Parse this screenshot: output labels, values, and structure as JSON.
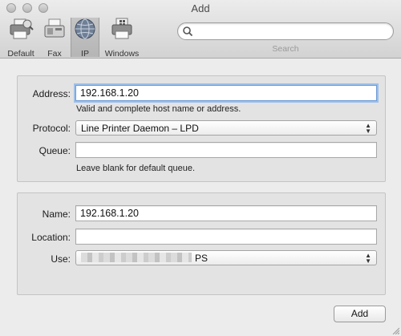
{
  "window": {
    "title": "Add"
  },
  "toolbar": {
    "items": [
      {
        "label": "Default",
        "icon": "default-printer-icon"
      },
      {
        "label": "Fax",
        "icon": "fax-icon"
      },
      {
        "label": "IP",
        "icon": "ip-globe-icon",
        "selected": true
      },
      {
        "label": "Windows",
        "icon": "windows-printer-icon"
      }
    ],
    "search": {
      "value": "",
      "label": "Search"
    }
  },
  "form": {
    "address": {
      "label": "Address:",
      "value": "192.168.1.20",
      "hint": "Valid and complete host name or address."
    },
    "protocol": {
      "label": "Protocol:",
      "value": "Line Printer Daemon – LPD"
    },
    "queue": {
      "label": "Queue:",
      "value": "",
      "hint": "Leave blank for default queue."
    },
    "name": {
      "label": "Name:",
      "value": "192.168.1.20"
    },
    "location": {
      "label": "Location:",
      "value": ""
    },
    "use": {
      "label": "Use:",
      "value_suffix": "PS"
    }
  },
  "buttons": {
    "add": "Add"
  },
  "colors": {
    "focus_ring": "#9bc0ea",
    "window_bg": "#ececec",
    "panel_bg": "#e3e3e3"
  }
}
